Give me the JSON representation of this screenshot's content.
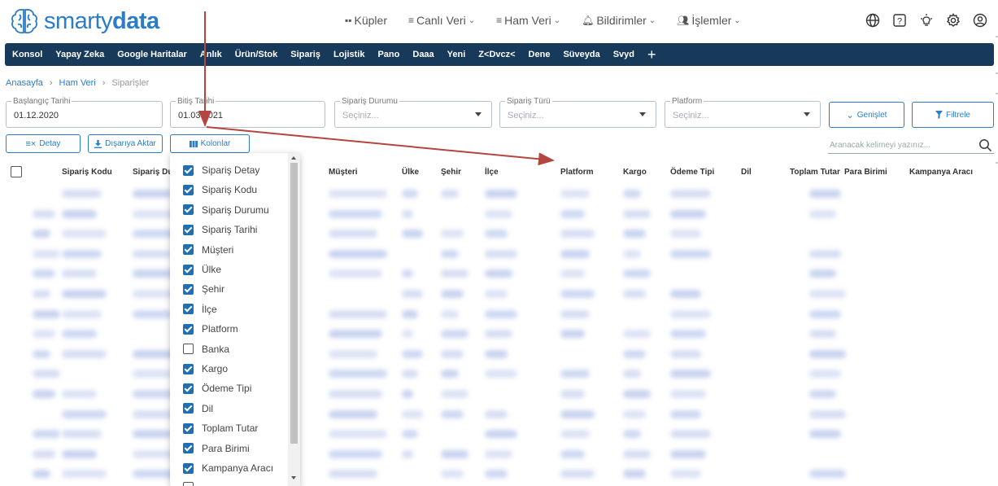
{
  "brand": {
    "logo_text_light": "smarty",
    "logo_text_bold": "data"
  },
  "topnav": [
    {
      "label": "Küpler",
      "icon": "grid-icon",
      "chevron": false
    },
    {
      "label": "Canlı Veri",
      "icon": "list-icon",
      "chevron": true
    },
    {
      "label": "Ham Veri",
      "icon": "list-icon",
      "chevron": true
    },
    {
      "label": "Bildirimler",
      "icon": "bell-icon",
      "chevron": true
    },
    {
      "label": "İşlemler",
      "icon": "users-icon",
      "chevron": true
    }
  ],
  "top_icons": [
    "globe-icon",
    "help-icon",
    "bulb-icon",
    "gear-icon",
    "user-icon"
  ],
  "menubar": [
    "Konsol",
    "Yapay Zeka",
    "Google Haritalar",
    "Anlık",
    "Ürün/Stok",
    "Sipariş",
    "Lojistik",
    "Pano",
    "Daaa",
    "Yeni",
    "Z<Dvcz<",
    "Dene",
    "Süveyda",
    "Svyd"
  ],
  "breadcrumb": {
    "home": "Anasayfa",
    "section": "Ham Veri",
    "current": "Siparişler"
  },
  "filters": {
    "start_date": {
      "label": "Başlangıç Tarihi",
      "value": "01.12.2020"
    },
    "end_date": {
      "label": "Bitiş Tarihi",
      "value": "01.03.2021"
    },
    "order_status": {
      "label": "Sipariş Durumu",
      "placeholder": "Seçiniz..."
    },
    "order_type": {
      "label": "Sipariş Türü",
      "placeholder": "Seçiniz..."
    },
    "platform": {
      "label": "Platform",
      "placeholder": "Seçiniz..."
    },
    "expand_label": "Genişlet",
    "filter_label": "Filtrele"
  },
  "actions": {
    "detail": "Detay",
    "export": "Dışarıya Aktar",
    "columns": "Kolonlar"
  },
  "search": {
    "placeholder": "Aranacak kelimeyi yazınız..."
  },
  "table": {
    "headers": [
      "Sipariş Kodu",
      "Sipariş Du",
      "Müşteri",
      "Ülke",
      "Şehir",
      "İlçe",
      "Platform",
      "Kargo",
      "Ödeme Tipi",
      "Dil",
      "Toplam Tutar",
      "Para Birimi",
      "Kampanya Aracı"
    ]
  },
  "column_menu": [
    {
      "label": "Sipariş Detay",
      "checked": true
    },
    {
      "label": "Sipariş Kodu",
      "checked": true
    },
    {
      "label": "Sipariş Durumu",
      "checked": true
    },
    {
      "label": "Sipariş Tarihi",
      "checked": true
    },
    {
      "label": "Müşteri",
      "checked": true
    },
    {
      "label": "Ülke",
      "checked": true
    },
    {
      "label": "Şehir",
      "checked": true
    },
    {
      "label": "İlçe",
      "checked": true
    },
    {
      "label": "Platform",
      "checked": true
    },
    {
      "label": "Banka",
      "checked": false
    },
    {
      "label": "Kargo",
      "checked": true
    },
    {
      "label": "Ödeme Tipi",
      "checked": true
    },
    {
      "label": "Dil",
      "checked": true
    },
    {
      "label": "Toplam Tutar",
      "checked": true
    },
    {
      "label": "Para Birimi",
      "checked": true
    },
    {
      "label": "Kampanya Aracı",
      "checked": true
    }
  ],
  "colors": {
    "primary": "#2a7dc6",
    "menubar": "#183a5a",
    "checkbox": "#1f6fb5",
    "annotation_arrow": "#b5463f"
  }
}
